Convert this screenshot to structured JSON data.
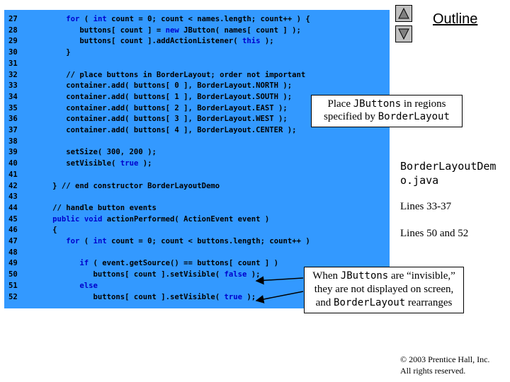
{
  "nav": {
    "outline_label": "Outline"
  },
  "code_lines": [
    {
      "ln": "27",
      "parts": [
        [
          "      "
        ],
        [
          "for",
          "kw"
        ],
        [
          " ( "
        ],
        [
          "int",
          "kw"
        ],
        [
          " count = "
        ],
        [
          "0"
        ],
        [
          "; count < names.length; count++ ) {"
        ]
      ]
    },
    {
      "ln": "28",
      "parts": [
        [
          "         buttons[ count ] = "
        ],
        [
          "new",
          "kw"
        ],
        [
          " JButton( names[ count ] );"
        ]
      ]
    },
    {
      "ln": "29",
      "parts": [
        [
          "         buttons[ count ].addActionListener( "
        ],
        [
          "this",
          "kw"
        ],
        [
          " );"
        ]
      ]
    },
    {
      "ln": "30",
      "parts": [
        [
          "      }"
        ]
      ]
    },
    {
      "ln": "31",
      "parts": [
        [
          ""
        ]
      ]
    },
    {
      "ln": "32",
      "parts": [
        [
          "      // place buttons in BorderLayout; order not important",
          "cm"
        ]
      ]
    },
    {
      "ln": "33",
      "parts": [
        [
          "      container.add( buttons[ 0 ], BorderLayout.NORTH );"
        ]
      ]
    },
    {
      "ln": "34",
      "parts": [
        [
          "      container.add( buttons[ 1 ], BorderLayout.SOUTH );"
        ]
      ]
    },
    {
      "ln": "35",
      "parts": [
        [
          "      container.add( buttons[ 2 ], BorderLayout.EAST );"
        ]
      ]
    },
    {
      "ln": "36",
      "parts": [
        [
          "      container.add( buttons[ 3 ], BorderLayout.WEST );"
        ]
      ]
    },
    {
      "ln": "37",
      "parts": [
        [
          "      container.add( buttons[ 4 ], BorderLayout.CENTER );"
        ]
      ]
    },
    {
      "ln": "38",
      "parts": [
        [
          ""
        ]
      ]
    },
    {
      "ln": "39",
      "parts": [
        [
          "      setSize( 300, 200 );"
        ]
      ]
    },
    {
      "ln": "40",
      "parts": [
        [
          "      setVisible( "
        ],
        [
          "true",
          "kw"
        ],
        [
          " );"
        ]
      ]
    },
    {
      "ln": "41",
      "parts": [
        [
          ""
        ]
      ]
    },
    {
      "ln": "42",
      "parts": [
        [
          "   } "
        ],
        [
          "// end constructor BorderLayoutDemo",
          "cm"
        ]
      ]
    },
    {
      "ln": "43",
      "parts": [
        [
          ""
        ]
      ]
    },
    {
      "ln": "44",
      "parts": [
        [
          "   "
        ],
        [
          "// handle button events",
          "cm"
        ]
      ]
    },
    {
      "ln": "45",
      "parts": [
        [
          "   "
        ],
        [
          "public",
          "kw"
        ],
        [
          " "
        ],
        [
          "void",
          "kw"
        ],
        [
          " actionPerformed( ActionEvent event )"
        ]
      ]
    },
    {
      "ln": "46",
      "parts": [
        [
          "   {"
        ]
      ]
    },
    {
      "ln": "47",
      "parts": [
        [
          "      "
        ],
        [
          "for",
          "kw"
        ],
        [
          " ( "
        ],
        [
          "int",
          "kw"
        ],
        [
          " count = "
        ],
        [
          "0"
        ],
        [
          "; count < buttons.length; count++ )"
        ]
      ]
    },
    {
      "ln": "48",
      "parts": [
        [
          ""
        ]
      ]
    },
    {
      "ln": "49",
      "parts": [
        [
          "         "
        ],
        [
          "if",
          "kw"
        ],
        [
          " ( event.getSource() == buttons[ count ] )"
        ]
      ]
    },
    {
      "ln": "50",
      "parts": [
        [
          "            buttons[ count ].setVisible( "
        ],
        [
          "false",
          "kw"
        ],
        [
          " );"
        ]
      ]
    },
    {
      "ln": "51",
      "parts": [
        [
          "         "
        ],
        [
          "else",
          "kw"
        ]
      ]
    },
    {
      "ln": "52",
      "parts": [
        [
          "            buttons[ count ].setVisible( "
        ],
        [
          "true",
          "kw"
        ],
        [
          " );"
        ]
      ]
    }
  ],
  "callouts": {
    "regions": {
      "t1": "Place ",
      "m1": "JButtons",
      "t2": " in regions specified by ",
      "m2": "BorderLayout"
    },
    "invisible": {
      "t1": "When ",
      "m1": "JButtons",
      "t2": " are “invisible,” they are not displayed on screen, and ",
      "m2": "BorderLayout",
      "t3": " rearranges"
    }
  },
  "sidebar": {
    "filename": "BorderLayoutDemo.java",
    "lines_a": "Lines 33-37",
    "lines_b": "Lines 50 and 52"
  },
  "footer": {
    "copyright": "© 2003 Prentice Hall, Inc.",
    "rights": "All rights reserved."
  }
}
